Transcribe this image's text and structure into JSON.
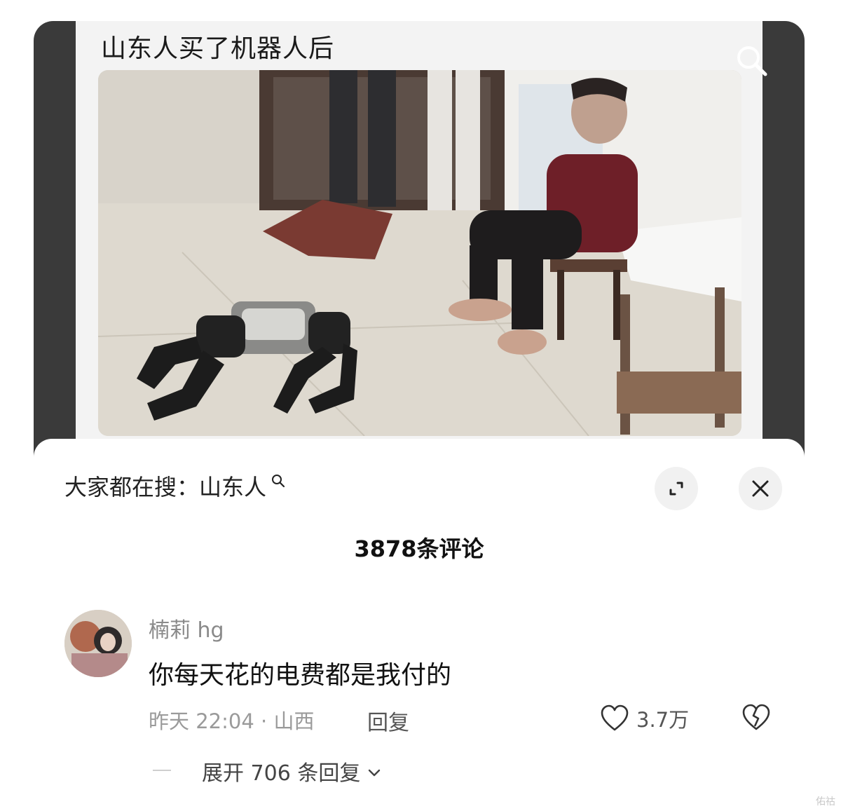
{
  "video": {
    "title": "山东人买了机器人后"
  },
  "sheet": {
    "trending_search": "大家都在搜：山东人",
    "comment_count": "3878条评论"
  },
  "comment": {
    "username": "楠莉 hg",
    "text": "你每天花的电费都是我付的",
    "meta": "昨天 22:04 · 山西",
    "reply_label": "回复",
    "like_count": "3.7万",
    "expand_replies": "展开 706 条回复"
  },
  "watermark": "佑祜",
  "icons": {
    "video_search": "search-icon",
    "trending_search": "search-icon",
    "expand": "expand-icon",
    "close": "close-icon",
    "like": "heart-icon",
    "dislike": "broken-heart-icon",
    "chevron": "chevron-down-icon"
  },
  "colors": {
    "frame": "#3a3a3a",
    "sheet": "#ffffff",
    "button_bg": "#f1f1f1",
    "muted_text": "#9a9a9a"
  }
}
